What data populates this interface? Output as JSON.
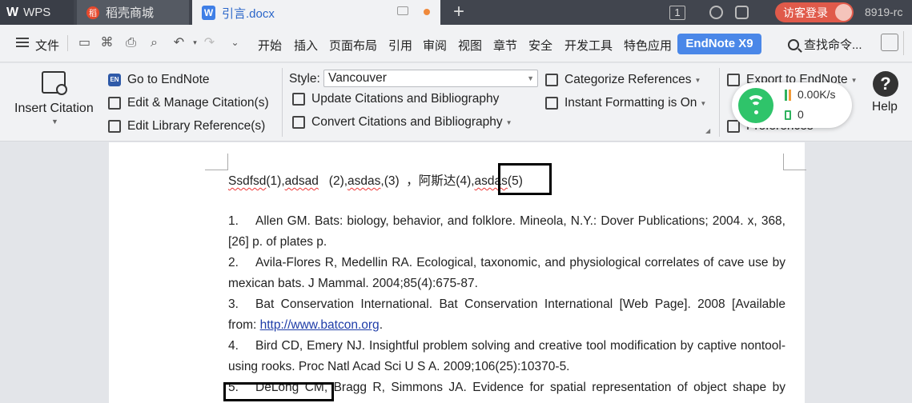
{
  "titlebar": {
    "tabs": [
      {
        "label": "WPS",
        "logo": "W"
      },
      {
        "label": "稻壳商城",
        "logo": "稻"
      },
      {
        "label": "引言.docx",
        "logo": "W"
      }
    ],
    "page_count_badge": "1",
    "login_label": "访客登录",
    "user_label": "8919-rc"
  },
  "menubar": {
    "file_label": "文件",
    "items": [
      "开始",
      "插入",
      "页面布局",
      "引用",
      "审阅",
      "视图",
      "章节",
      "安全",
      "开发工具",
      "特色应用"
    ],
    "active_tab": "EndNote X9",
    "search_label": "查找命令..."
  },
  "ribbon": {
    "insert_citation": "Insert Citation",
    "go_to_endnote": "Go to EndNote",
    "edit_manage": "Edit & Manage Citation(s)",
    "edit_library": "Edit Library Reference(s)",
    "style_label": "Style:",
    "style_value": "Vancouver",
    "update_citations": "Update Citations and Bibliography",
    "convert_citations": "Convert Citations and Bibliography",
    "categorize": "Categorize References",
    "instant_formatting": "Instant Formatting is On",
    "export_to_endnote": "Export to EndNote",
    "preferences": "Preferences",
    "help": "Help",
    "help_glyph": "?"
  },
  "network_widget": {
    "speed": "0.00K/s",
    "memory": "0"
  },
  "document": {
    "citation_line_parts": [
      "Ssdfsd",
      "(1),",
      "adsad",
      "   (2),",
      "asdas",
      ",(3)  ，阿斯达(4),",
      "asdas",
      "(5)"
    ],
    "references": [
      {
        "num": "1.",
        "text": "Allen GM. Bats: biology, behavior, and folklore. Mineola, N.Y.: Dover Publications; 2004. x, 368, [26] p. of plates p."
      },
      {
        "num": "2.",
        "text": "Avila-Flores R, Medellin RA. Ecological, taxonomic, and physiological correlates of cave use by mexican bats. J Mammal. 2004;85(4):675-87."
      },
      {
        "num": "3.",
        "text": "Bat Conservation International. Bat Conservation International [Web Page]. 2008 [Available from: ",
        "link": "http://www.batcon.org",
        "after": "."
      },
      {
        "num": "4.",
        "text": "Bird CD, Emery NJ. Insightful problem solving and creative tool modification by captive nontool-using rooks. Proc Natl Acad Sci U S A. 2009;106(25):10370-5."
      },
      {
        "num": "5.",
        "text": "DeLong CM, Bragg R, Simmons JA. Evidence for spatial representation of object shape by"
      }
    ]
  },
  "colors": {
    "titlebar": "#41454e",
    "accent_tab": "#4a87e8",
    "login": "#e05a4a",
    "wifi": "#2fc46a",
    "link": "#1e3ca8"
  }
}
